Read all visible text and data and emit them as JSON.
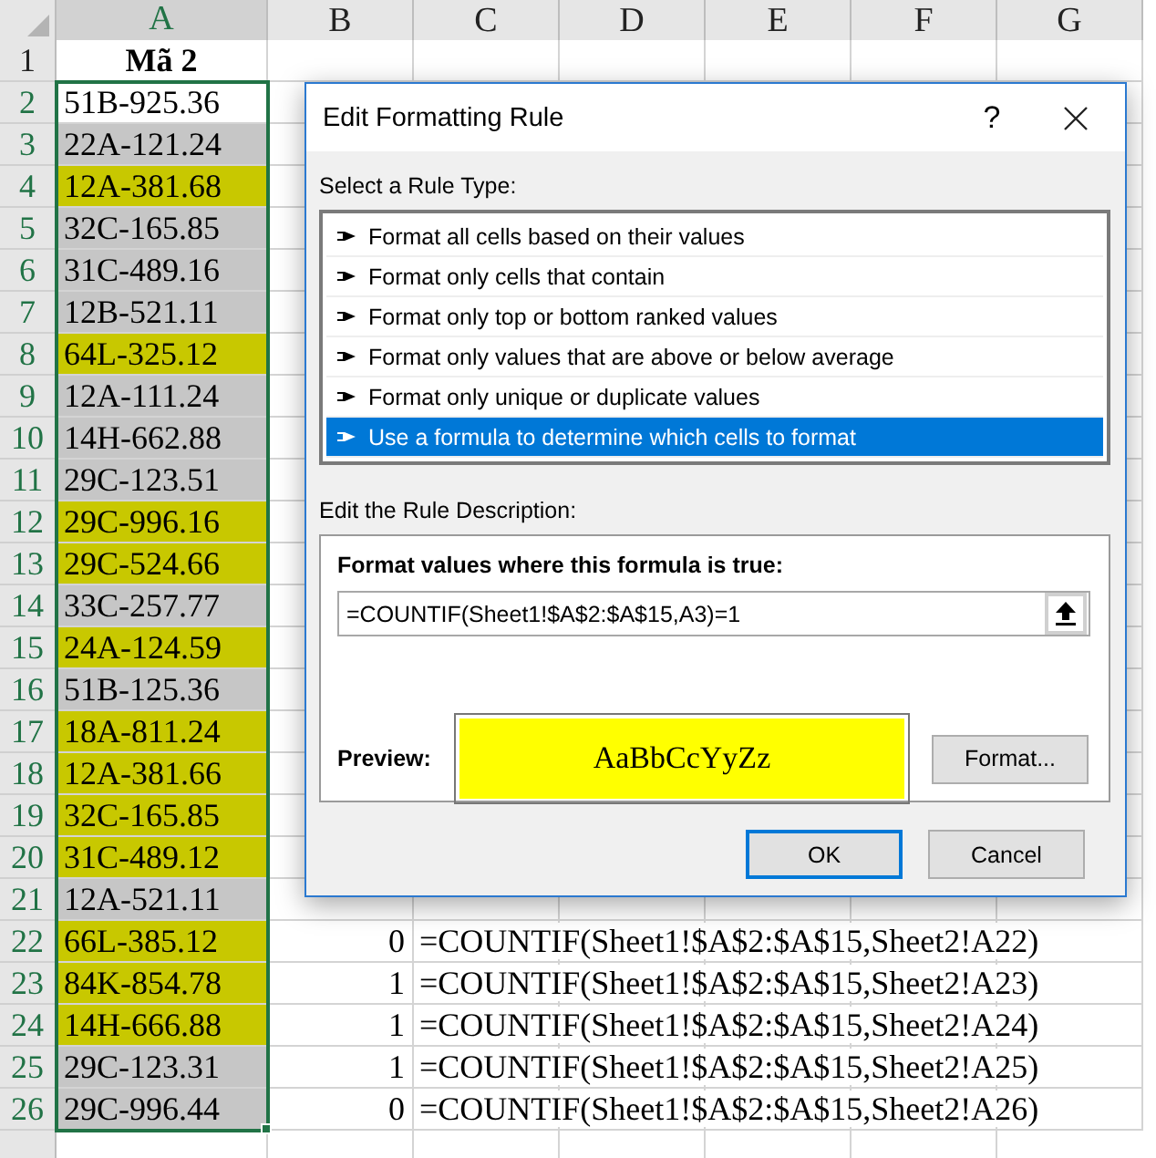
{
  "sheet": {
    "columns": [
      {
        "label": "A",
        "selected": true
      },
      {
        "label": "B",
        "selected": false
      },
      {
        "label": "C",
        "selected": false
      },
      {
        "label": "D",
        "selected": false
      },
      {
        "label": "E",
        "selected": false
      },
      {
        "label": "F",
        "selected": false
      },
      {
        "label": "G",
        "selected": false
      }
    ],
    "title_row": {
      "number": "1",
      "label": "Mã 2"
    },
    "rows": [
      {
        "number": "2",
        "code": "51B-925.36",
        "highlighted": false,
        "active": true
      },
      {
        "number": "3",
        "code": "22A-121.24",
        "highlighted": false,
        "active": false
      },
      {
        "number": "4",
        "code": "12A-381.68",
        "highlighted": true,
        "active": false
      },
      {
        "number": "5",
        "code": "32C-165.85",
        "highlighted": false,
        "active": false
      },
      {
        "number": "6",
        "code": "31C-489.16",
        "highlighted": false,
        "active": false
      },
      {
        "number": "7",
        "code": "12B-521.11",
        "highlighted": false,
        "active": false
      },
      {
        "number": "8",
        "code": "64L-325.12",
        "highlighted": true,
        "active": false
      },
      {
        "number": "9",
        "code": "12A-111.24",
        "highlighted": false,
        "active": false
      },
      {
        "number": "10",
        "code": "14H-662.88",
        "highlighted": false,
        "active": false
      },
      {
        "number": "11",
        "code": "29C-123.51",
        "highlighted": false,
        "active": false
      },
      {
        "number": "12",
        "code": "29C-996.16",
        "highlighted": true,
        "active": false
      },
      {
        "number": "13",
        "code": "29C-524.66",
        "highlighted": true,
        "active": false
      },
      {
        "number": "14",
        "code": "33C-257.77",
        "highlighted": false,
        "active": false
      },
      {
        "number": "15",
        "code": "24A-124.59",
        "highlighted": true,
        "active": false
      },
      {
        "number": "16",
        "code": "51B-125.36",
        "highlighted": false,
        "active": false
      },
      {
        "number": "17",
        "code": "18A-811.24",
        "highlighted": true,
        "active": false
      },
      {
        "number": "18",
        "code": "12A-381.66",
        "highlighted": true,
        "active": false
      },
      {
        "number": "19",
        "code": "32C-165.85",
        "highlighted": true,
        "active": false
      },
      {
        "number": "20",
        "code": "31C-489.12",
        "highlighted": true,
        "active": false
      },
      {
        "number": "21",
        "code": "12A-521.11",
        "highlighted": false,
        "active": false
      },
      {
        "number": "22",
        "code": "66L-385.12",
        "highlighted": true,
        "active": false,
        "count": "0",
        "formula": "=COUNTIF(Sheet1!$A$2:$A$15,Sheet2!A22)"
      },
      {
        "number": "23",
        "code": "84K-854.78",
        "highlighted": true,
        "active": false,
        "count": "1",
        "formula": "=COUNTIF(Sheet1!$A$2:$A$15,Sheet2!A23)"
      },
      {
        "number": "24",
        "code": "14H-666.88",
        "highlighted": true,
        "active": false,
        "count": "1",
        "formula": "=COUNTIF(Sheet1!$A$2:$A$15,Sheet2!A24)"
      },
      {
        "number": "25",
        "code": "29C-123.31",
        "highlighted": false,
        "active": false,
        "count": "1",
        "formula": "=COUNTIF(Sheet1!$A$2:$A$15,Sheet2!A25)"
      },
      {
        "number": "26",
        "code": "29C-996.44",
        "highlighted": false,
        "active": false,
        "count": "0",
        "formula": "=COUNTIF(Sheet1!$A$2:$A$15,Sheet2!A26)"
      }
    ]
  },
  "dialog": {
    "title": "Edit Formatting Rule",
    "help": "?",
    "rule_type_label": "Select a Rule Type:",
    "rule_types": [
      {
        "label": "Format all cells based on their values",
        "selected": false
      },
      {
        "label": "Format only cells that contain",
        "selected": false
      },
      {
        "label": "Format only top or bottom ranked values",
        "selected": false
      },
      {
        "label": "Format only values that are above or below average",
        "selected": false
      },
      {
        "label": "Format only unique or duplicate values",
        "selected": false
      },
      {
        "label": "Use a formula to determine which cells to format",
        "selected": true
      }
    ],
    "description_label": "Edit the Rule Description:",
    "formula_label": "Format values where this formula is true:",
    "formula": "=COUNTIF(Sheet1!$A$2:$A$15,A3)=1",
    "preview_label": "Preview:",
    "preview_text": "AaBbCcYyZz",
    "format_button": "Format...",
    "buttons": [
      {
        "label": "OK",
        "default": true
      },
      {
        "label": "Cancel",
        "default": false
      }
    ]
  }
}
